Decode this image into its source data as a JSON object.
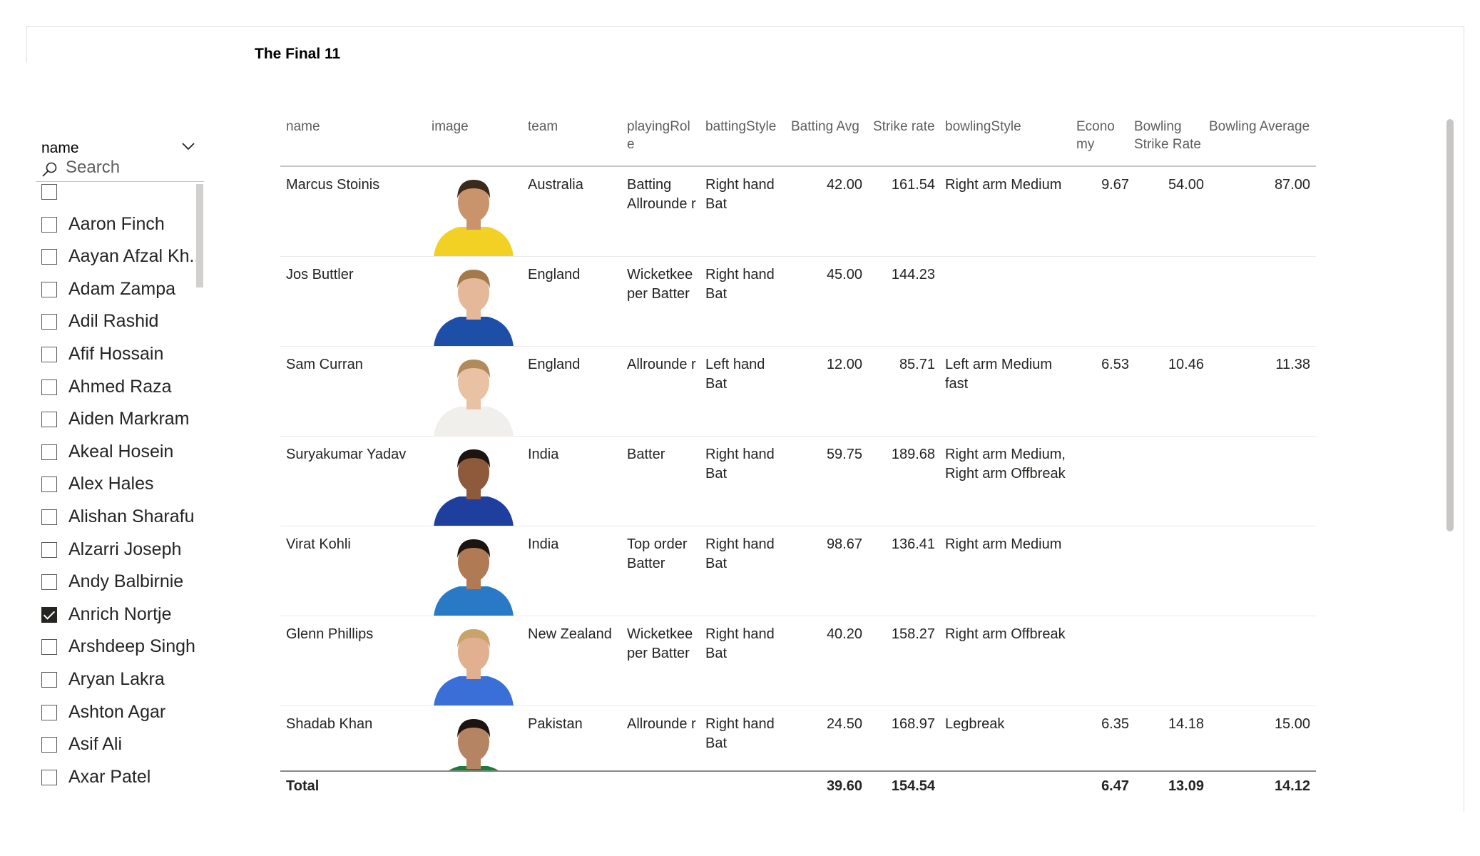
{
  "visual": {
    "title": "The Final 11"
  },
  "slicer": {
    "title": "name",
    "search_placeholder": "Search",
    "items": [
      {
        "label": "",
        "checked": false
      },
      {
        "label": "Aaron Finch",
        "checked": false
      },
      {
        "label": "Aayan Afzal Kh...",
        "checked": false
      },
      {
        "label": "Adam Zampa",
        "checked": false
      },
      {
        "label": "Adil Rashid",
        "checked": false
      },
      {
        "label": "Afif Hossain",
        "checked": false
      },
      {
        "label": "Ahmed Raza",
        "checked": false
      },
      {
        "label": "Aiden Markram",
        "checked": false
      },
      {
        "label": "Akeal Hosein",
        "checked": false
      },
      {
        "label": "Alex Hales",
        "checked": false
      },
      {
        "label": "Alishan Sharafu",
        "checked": false
      },
      {
        "label": "Alzarri Joseph",
        "checked": false
      },
      {
        "label": "Andy Balbirnie",
        "checked": false
      },
      {
        "label": "Anrich Nortje",
        "checked": true
      },
      {
        "label": "Arshdeep Singh",
        "checked": false
      },
      {
        "label": "Aryan Lakra",
        "checked": false
      },
      {
        "label": "Ashton Agar",
        "checked": false
      },
      {
        "label": "Asif Ali",
        "checked": false
      },
      {
        "label": "Axar Patel",
        "checked": false
      }
    ]
  },
  "table": {
    "headers": {
      "name": "name",
      "image": "image",
      "team": "team",
      "playingRole": "playingRol e",
      "battingStyle": "battingStyle",
      "battingAvg": "Batting Avg",
      "strikeRate": "Strike rate",
      "bowlingStyle": "bowlingStyle",
      "economy": "Econo my",
      "bowlingSR": "Bowling Strike Rate",
      "bowlingAvg": "Bowling Average"
    },
    "rows": [
      {
        "name": "Marcus Stoinis",
        "team": "Australia",
        "playingRole": "Batting Allrounde r",
        "battingStyle": "Right hand Bat",
        "battingAvg": "42.00",
        "strikeRate": "161.54",
        "bowlingStyle": "Right arm Medium",
        "economy": "9.67",
        "bowlingSR": "54.00",
        "bowlingAvg": "87.00",
        "jersey": "#f2d024",
        "skin": "#c9946b",
        "hair": "#3a2a1e"
      },
      {
        "name": "Jos Buttler",
        "team": "England",
        "playingRole": "Wicketkee per Batter",
        "battingStyle": "Right hand Bat",
        "battingAvg": "45.00",
        "strikeRate": "144.23",
        "bowlingStyle": "",
        "economy": "",
        "bowlingSR": "",
        "bowlingAvg": "",
        "jersey": "#1e4fa8",
        "skin": "#e6b89a",
        "hair": "#a57a4a"
      },
      {
        "name": "Sam Curran",
        "team": "England",
        "playingRole": "Allrounde r",
        "battingStyle": "Left hand Bat",
        "battingAvg": "12.00",
        "strikeRate": "85.71",
        "bowlingStyle": "Left arm Medium fast",
        "economy": "6.53",
        "bowlingSR": "10.46",
        "bowlingAvg": "11.38",
        "jersey": "#f1efec",
        "skin": "#e8c2a2",
        "hair": "#b08a5a"
      },
      {
        "name": "Suryakumar Yadav",
        "team": "India",
        "playingRole": "Batter",
        "battingStyle": "Right hand Bat",
        "battingAvg": "59.75",
        "strikeRate": "189.68",
        "bowlingStyle": "Right arm Medium, Right arm Offbreak",
        "economy": "",
        "bowlingSR": "",
        "bowlingAvg": "",
        "jersey": "#1f3f9e",
        "skin": "#8d5a3b",
        "hair": "#1c1410"
      },
      {
        "name": "Virat Kohli",
        "team": "India",
        "playingRole": "Top order Batter",
        "battingStyle": "Right hand Bat",
        "battingAvg": "98.67",
        "strikeRate": "136.41",
        "bowlingStyle": "Right arm Medium",
        "economy": "",
        "bowlingSR": "",
        "bowlingAvg": "",
        "jersey": "#2a79c7",
        "skin": "#b07a55",
        "hair": "#1c1410"
      },
      {
        "name": "Glenn Phillips",
        "team": "New Zealand",
        "playingRole": "Wicketkee per Batter",
        "battingStyle": "Right hand Bat",
        "battingAvg": "40.20",
        "strikeRate": "158.27",
        "bowlingStyle": "Right arm Offbreak",
        "economy": "",
        "bowlingSR": "",
        "bowlingAvg": "",
        "jersey": "#3b6fd8",
        "skin": "#e0b091",
        "hair": "#c9a46a"
      },
      {
        "name": "Shadab Khan",
        "team": "Pakistan",
        "playingRole": "Allrounde r",
        "battingStyle": "Right hand Bat",
        "battingAvg": "24.50",
        "strikeRate": "168.97",
        "bowlingStyle": "Legbreak",
        "economy": "6.35",
        "bowlingSR": "14.18",
        "bowlingAvg": "15.00",
        "jersey": "#1d7a3a",
        "skin": "#b58563",
        "hair": "#1c1410"
      }
    ],
    "total": {
      "label": "Total",
      "battingAvg": "39.60",
      "strikeRate": "154.54",
      "economy": "6.47",
      "bowlingSR": "13.09",
      "bowlingAvg": "14.12"
    }
  }
}
